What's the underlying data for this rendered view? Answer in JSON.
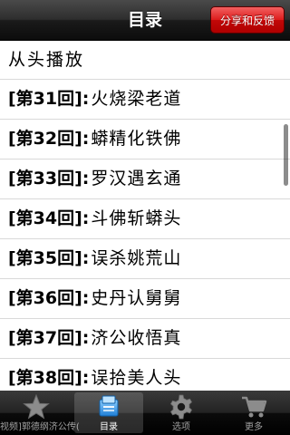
{
  "navbar": {
    "title": "目录",
    "share_label": "分享和反馈"
  },
  "list": {
    "items": [
      {
        "num": "",
        "title": "从头播放"
      },
      {
        "num": "[第31回]:",
        "title": "火烧梁老道"
      },
      {
        "num": "[第32回]:",
        "title": "蟒精化铁佛"
      },
      {
        "num": "[第33回]:",
        "title": "罗汉遇玄通"
      },
      {
        "num": "[第34回]:",
        "title": "斗佛斩蟒头"
      },
      {
        "num": "[第35回]:",
        "title": "误杀姚荒山"
      },
      {
        "num": "[第36回]:",
        "title": "史丹认舅舅"
      },
      {
        "num": "[第37回]:",
        "title": "济公收悟真"
      },
      {
        "num": "[第38回]:",
        "title": "误拾美人头"
      }
    ]
  },
  "tabbar": {
    "tabs": [
      {
        "label": "视频]郭德纲济公传(下)",
        "icon": "star-icon"
      },
      {
        "label": "目录",
        "icon": "book-icon",
        "active": true
      },
      {
        "label": "选项",
        "icon": "gear-icon"
      },
      {
        "label": "更多",
        "icon": "cart-icon"
      }
    ]
  },
  "colors": {
    "navbar": "#1a1a1a",
    "share_button": "#d01414",
    "tabbar": "#111111",
    "active_tab_icon": "#4aa3f0"
  }
}
